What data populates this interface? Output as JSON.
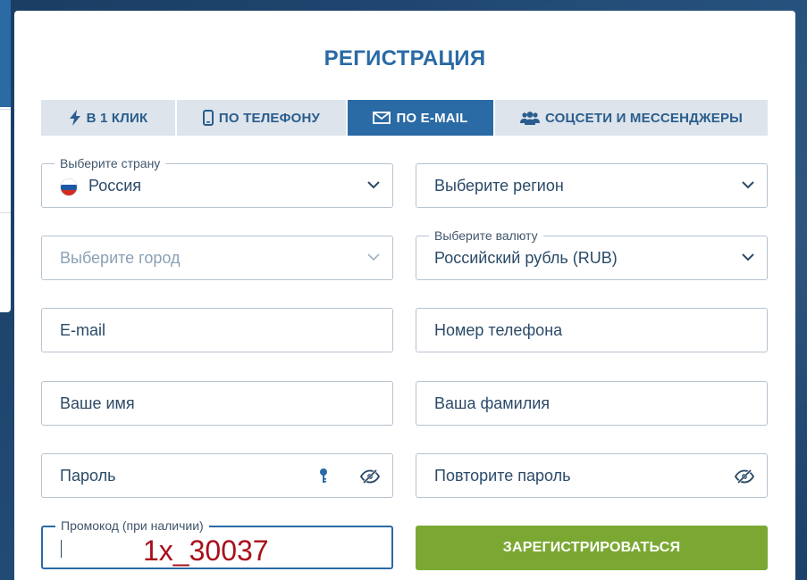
{
  "title": "РЕГИСТРАЦИЯ",
  "tabs": [
    {
      "label": "В 1 КЛИК",
      "icon": "bolt-icon",
      "active": false
    },
    {
      "label": "ПО ТЕЛЕФОНУ",
      "icon": "phone-icon",
      "active": false
    },
    {
      "label": "ПО E-MAIL",
      "icon": "envelope-icon",
      "active": true
    },
    {
      "label": "СОЦСЕТИ И МЕССЕНДЖЕРЫ",
      "icon": "users-icon",
      "active": false
    }
  ],
  "form": {
    "country": {
      "label": "Выберите страну",
      "value": "Россия"
    },
    "region": {
      "placeholder": "Выберите регион"
    },
    "city": {
      "placeholder": "Выберите город"
    },
    "currency": {
      "label": "Выберите валюту",
      "value": "Российский рубль (RUB)"
    },
    "email": {
      "placeholder": "E-mail"
    },
    "phone": {
      "placeholder": "Номер телефона"
    },
    "first_name": {
      "placeholder": "Ваше имя"
    },
    "last_name": {
      "placeholder": "Ваша фамилия"
    },
    "password": {
      "placeholder": "Пароль"
    },
    "password_repeat": {
      "placeholder": "Повторите пароль"
    },
    "promo": {
      "label": "Промокод (при наличии)",
      "value": "1x_30037"
    },
    "submit_label": "ЗАРЕГИСТРИРОВАТЬСЯ"
  },
  "colors": {
    "accent": "#2a6aa5",
    "submit": "#7ba833",
    "promo_text": "#a8101b",
    "background": "#1e4670"
  }
}
